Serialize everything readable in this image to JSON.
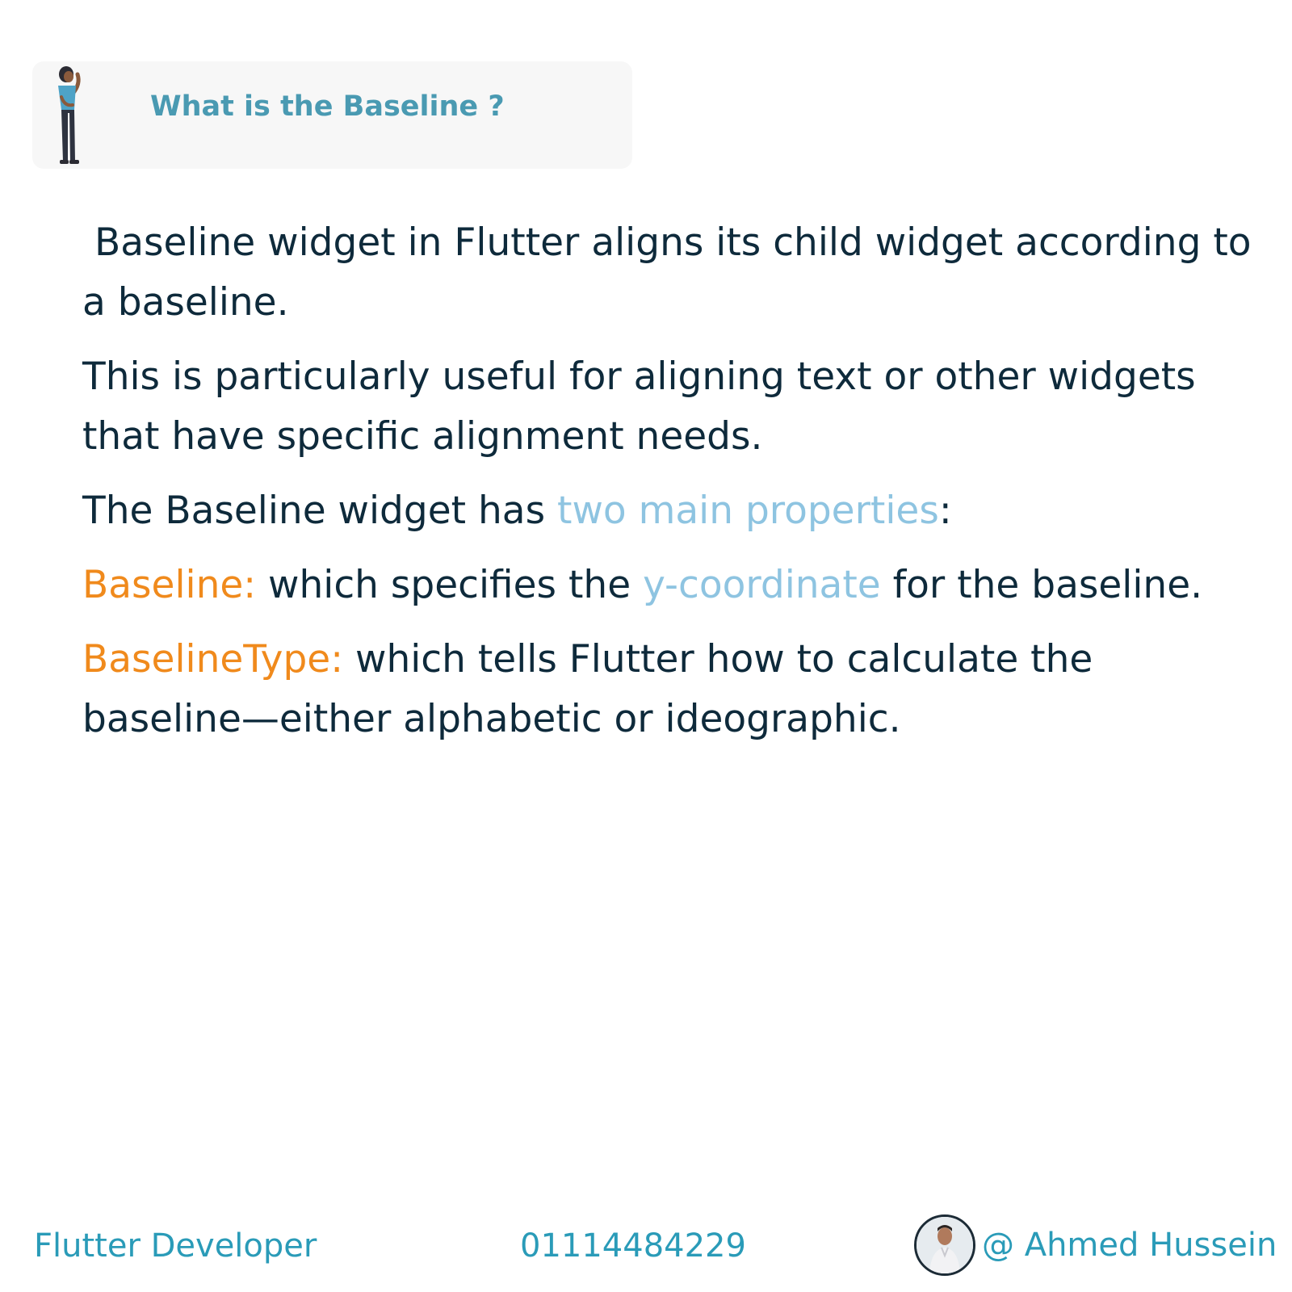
{
  "header": {
    "title": "What is the Baseline ?"
  },
  "content": {
    "p1": "Baseline widget in Flutter aligns its child widget according to a baseline.",
    "p2": "This is particularly useful for aligning text or other widgets that have specific alignment needs.",
    "p3_before": "The Baseline widget has ",
    "p3_highlight": "two main properties",
    "p3_after": ":",
    "p4_keyword": "Baseline:",
    "p4_before": " which specifies the ",
    "p4_highlight": "y-coordinate",
    "p4_after": " for the baseline.",
    "p5_keyword": "BaselineType:",
    "p5_text": " which tells Flutter how to calculate the baseline—either alphabetic or ideographic."
  },
  "footer": {
    "role": "Flutter Developer",
    "phone": "01114484229",
    "handle": "@ Ahmed Hussein"
  },
  "colors": {
    "title": "#4a9ab2",
    "body_text": "#0e2a3b",
    "highlight": "#8ec4e1",
    "keyword": "#f08a1c",
    "footer": "#2a9bb8"
  }
}
